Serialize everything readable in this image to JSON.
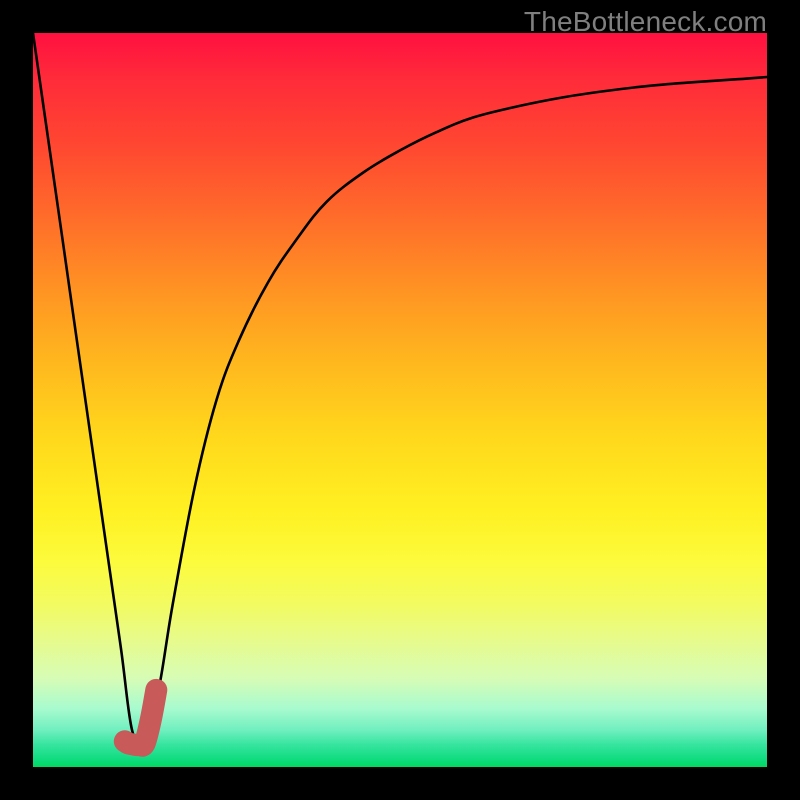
{
  "watermark": "TheBottleneck.com",
  "accent_color": "#c85a5a",
  "curve_color": "#000000",
  "chart_data": {
    "type": "line",
    "title": "",
    "xlabel": "",
    "ylabel": "",
    "xlim": [
      0,
      100
    ],
    "ylim": [
      0,
      100
    ],
    "series": [
      {
        "name": "bottleneck-curve",
        "x": [
          0,
          2,
          4,
          6,
          8,
          10,
          12,
          13.5,
          15,
          17,
          19,
          22,
          25,
          28,
          32,
          36,
          40,
          45,
          50,
          55,
          60,
          66,
          72,
          78,
          84,
          90,
          96,
          100
        ],
        "y": [
          100,
          86,
          72,
          58,
          44,
          30,
          16,
          5,
          4,
          10,
          22,
          38,
          50,
          58,
          66,
          72,
          77,
          81,
          84,
          86.5,
          88.5,
          90,
          91.2,
          92.1,
          92.8,
          93.3,
          93.7,
          94
        ]
      },
      {
        "name": "highlight-segment",
        "x": [
          12.5,
          13,
          13.5,
          14,
          14.5,
          15.2,
          16,
          16.8
        ],
        "y": [
          3.5,
          3.2,
          3.1,
          3.0,
          3.0,
          3.2,
          6.2,
          10.5
        ]
      }
    ]
  }
}
